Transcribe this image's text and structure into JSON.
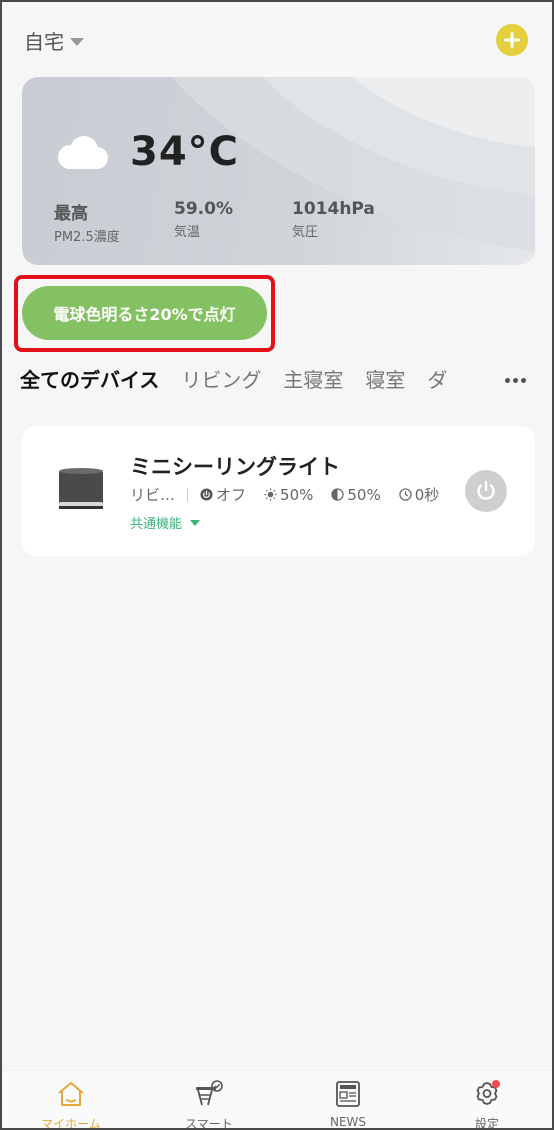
{
  "header": {
    "home_name": "自宅"
  },
  "weather": {
    "temperature": "34°C",
    "stats": [
      {
        "value": "最高",
        "label": "PM2.5濃度"
      },
      {
        "value": "59.0%",
        "label": "気温"
      },
      {
        "value": "1014hPa",
        "label": "気圧"
      }
    ]
  },
  "scene": {
    "label": "電球色明るさ20%で点灯"
  },
  "tabs": [
    "全てのデバイス",
    "リビング",
    "主寝室",
    "寝室",
    "ダ"
  ],
  "device": {
    "name": "ミニシーリングライト",
    "room": "リビ…",
    "power_state": "オフ",
    "brightness": "50%",
    "color_temp": "50%",
    "timer": "0秒",
    "common_function": "共通機能"
  },
  "nav": [
    {
      "label": "マイホーム"
    },
    {
      "label": "スマート"
    },
    {
      "label": "NEWS"
    },
    {
      "label": "設定"
    }
  ],
  "colors": {
    "accent_yellow": "#e6cf3d",
    "scene_green": "#84c162",
    "highlight_red": "#e3101a",
    "link_green": "#3cb47c",
    "nav_active": "#e0a93a"
  }
}
